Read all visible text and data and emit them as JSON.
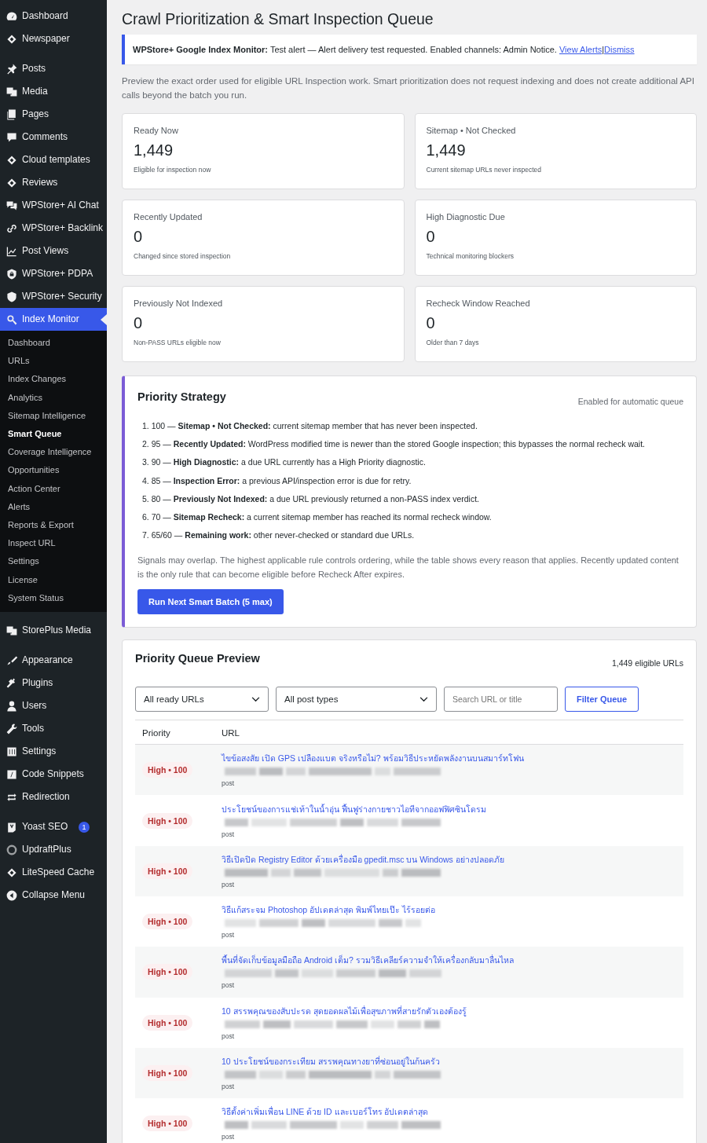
{
  "sidebar": {
    "groups": [
      [
        {
          "label": "Dashboard",
          "selected": false
        },
        {
          "label": "Newspaper",
          "selected": false
        }
      ],
      [
        {
          "label": "Posts",
          "selected": false
        },
        {
          "label": "Media",
          "selected": false
        },
        {
          "label": "Pages",
          "selected": false
        },
        {
          "label": "Comments",
          "selected": false
        },
        {
          "label": "Cloud templates",
          "selected": false
        },
        {
          "label": "Reviews",
          "selected": false
        },
        {
          "label": "WPStore+ AI Chat",
          "selected": false
        },
        {
          "label": "WPStore+ Backlink",
          "selected": false
        },
        {
          "label": "Post Views",
          "selected": false
        },
        {
          "label": "WPStore+ PDPA",
          "selected": false
        },
        {
          "label": "WPStore+ Security",
          "selected": false
        },
        {
          "label": "Index Monitor",
          "selected": true,
          "children": [
            {
              "label": "Dashboard",
              "selected": false
            },
            {
              "label": "URLs",
              "selected": false
            },
            {
              "label": "Index Changes",
              "selected": false
            },
            {
              "label": "Analytics",
              "selected": false
            },
            {
              "label": "Sitemap Intelligence",
              "selected": false
            },
            {
              "label": "Smart Queue",
              "selected": true
            },
            {
              "label": "Coverage Intelligence",
              "selected": false
            },
            {
              "label": "Opportunities",
              "selected": false
            },
            {
              "label": "Action Center",
              "selected": false
            },
            {
              "label": "Alerts",
              "selected": false
            },
            {
              "label": "Reports & Export",
              "selected": false
            },
            {
              "label": "Inspect URL",
              "selected": false
            },
            {
              "label": "Settings",
              "selected": false
            },
            {
              "label": "License",
              "selected": false
            },
            {
              "label": "System Status",
              "selected": false
            }
          ]
        }
      ],
      [
        {
          "label": "StorePlus Media",
          "selected": false
        }
      ],
      [
        {
          "label": "Appearance",
          "selected": false
        },
        {
          "label": "Plugins",
          "selected": false
        },
        {
          "label": "Users",
          "selected": false
        },
        {
          "label": "Tools",
          "selected": false
        },
        {
          "label": "Settings",
          "selected": false
        },
        {
          "label": "Code Snippets",
          "selected": false
        },
        {
          "label": "Redirection",
          "selected": false
        }
      ],
      [
        {
          "label": "Yoast SEO",
          "selected": false,
          "badge": "1"
        },
        {
          "label": "UpdraftPlus",
          "selected": false
        },
        {
          "label": "LiteSpeed Cache",
          "selected": false
        },
        {
          "label": "Collapse Menu",
          "selected": false
        }
      ]
    ]
  },
  "page": {
    "title": "Crawl Prioritization & Smart Inspection Queue",
    "notice": {
      "text": "**WPStore+ Google Index Monitor:** Test alert — Alert delivery test requested. Enabled channels: Admin Notice.",
      "links": [
        "View Alerts",
        "Dismiss"
      ],
      "link_separator": "|"
    },
    "description": "Preview the exact order used for eligible URL Inspection work. Smart prioritization does not request indexing and does not create additional API calls beyond the batch you run.",
    "stats": [
      {
        "label": "Ready Now",
        "value": "1,449",
        "note": "Eligible for inspection now"
      },
      {
        "label": "Sitemap • Not Checked",
        "value": "1,449",
        "note": "Current sitemap URLs never inspected"
      },
      {
        "label": "Recently Updated",
        "value": "0",
        "note": "Changed since stored inspection"
      },
      {
        "label": "High Diagnostic Due",
        "value": "0",
        "note": "Technical monitoring blockers"
      },
      {
        "label": "Previously Not Indexed",
        "value": "0",
        "note": "Non-PASS URLs eligible now"
      },
      {
        "label": "Recheck Window Reached",
        "value": "0",
        "note": "Older than 7 days"
      }
    ],
    "strategy": {
      "title": "Priority Strategy",
      "status": "Enabled for automatic queue",
      "rules": [
        "1. 100 — **Sitemap • Not Checked:** current sitemap member that has never been inspected.",
        "2. 95 — **Recently Updated:** WordPress modified time is newer than the stored Google inspection; this bypasses the normal recheck wait.",
        "3. 90 — **High Diagnostic:** a due URL currently has a High Priority diagnostic.",
        "4. 85 — **Inspection Error:** a previous API/inspection error is due for retry.",
        "5. 80 — **Previously Not Indexed:** a due URL previously returned a non-PASS index verdict.",
        "6. 70 — **Sitemap Recheck:** a current sitemap member has reached its normal recheck window.",
        "7. 65/60 — **Remaining work:** other never-checked or standard due URLs."
      ],
      "note": "Signals may overlap. The highest applicable rule controls ordering, while the table shows every reason that applies. Recently updated content is the only rule that can become eligible before Recheck After expires.",
      "button": "Run Next Smart Batch (5 max)"
    },
    "queue": {
      "title": "Priority Queue Preview",
      "count": "1,449 eligible URLs",
      "filters": {
        "status": "All ready URLs",
        "post_type": "All post types",
        "search_placeholder": "Search URL or title",
        "button": "Filter Queue"
      },
      "columns": [
        "Priority",
        "URL"
      ],
      "rows": [
        {
          "priority": "High • 100",
          "title": "ไขข้อสงสัย เปิด GPS เปลืองแบต จริงหรือไม่? พร้อมวิธีประหยัดพลังงานบนสมาร์ทโฟน",
          "type": "post"
        },
        {
          "priority": "High • 100",
          "title": "ประโยชน์ของการแช่เท้าในน้ำอุ่น ฟื้นฟูร่างกายชาวไอทีจากออฟฟิศซินโดรม",
          "type": "post"
        },
        {
          "priority": "High • 100",
          "title": "วิธีเปิดปิด Registry Editor ด้วยเครื่องมือ gpedit.msc บน Windows อย่างปลอดภัย",
          "type": "post"
        },
        {
          "priority": "High • 100",
          "title": "วิธีแก้สระจม Photoshop อัปเดตล่าสุด พิมพ์ไทยเป๊ะ ไร้รอยต่อ",
          "type": "post"
        },
        {
          "priority": "High • 100",
          "title": "พื้นที่จัดเก็บข้อมูลมือถือ Android เต็ม? รวมวิธีเคลียร์ความจำให้เครื่องกลับมาลื่นไหล",
          "type": "post"
        },
        {
          "priority": "High • 100",
          "title": "10 สรรพคุณของสับปะรด สุดยอดผลไม้เพื่อสุขภาพที่สายรักตัวเองต้องรู้",
          "type": "post"
        },
        {
          "priority": "High • 100",
          "title": "10 ประโยชน์ของกระเทียม สรรพคุณทางยาที่ซ่อนอยู่ในก้นครัว",
          "type": "post"
        },
        {
          "priority": "High • 100",
          "title": "วิธีตั้งค่าเพิ่มเพื่อน LINE ด้วย ID และเบอร์โทร อัปเดตล่าสุด",
          "type": "post"
        }
      ]
    }
  }
}
